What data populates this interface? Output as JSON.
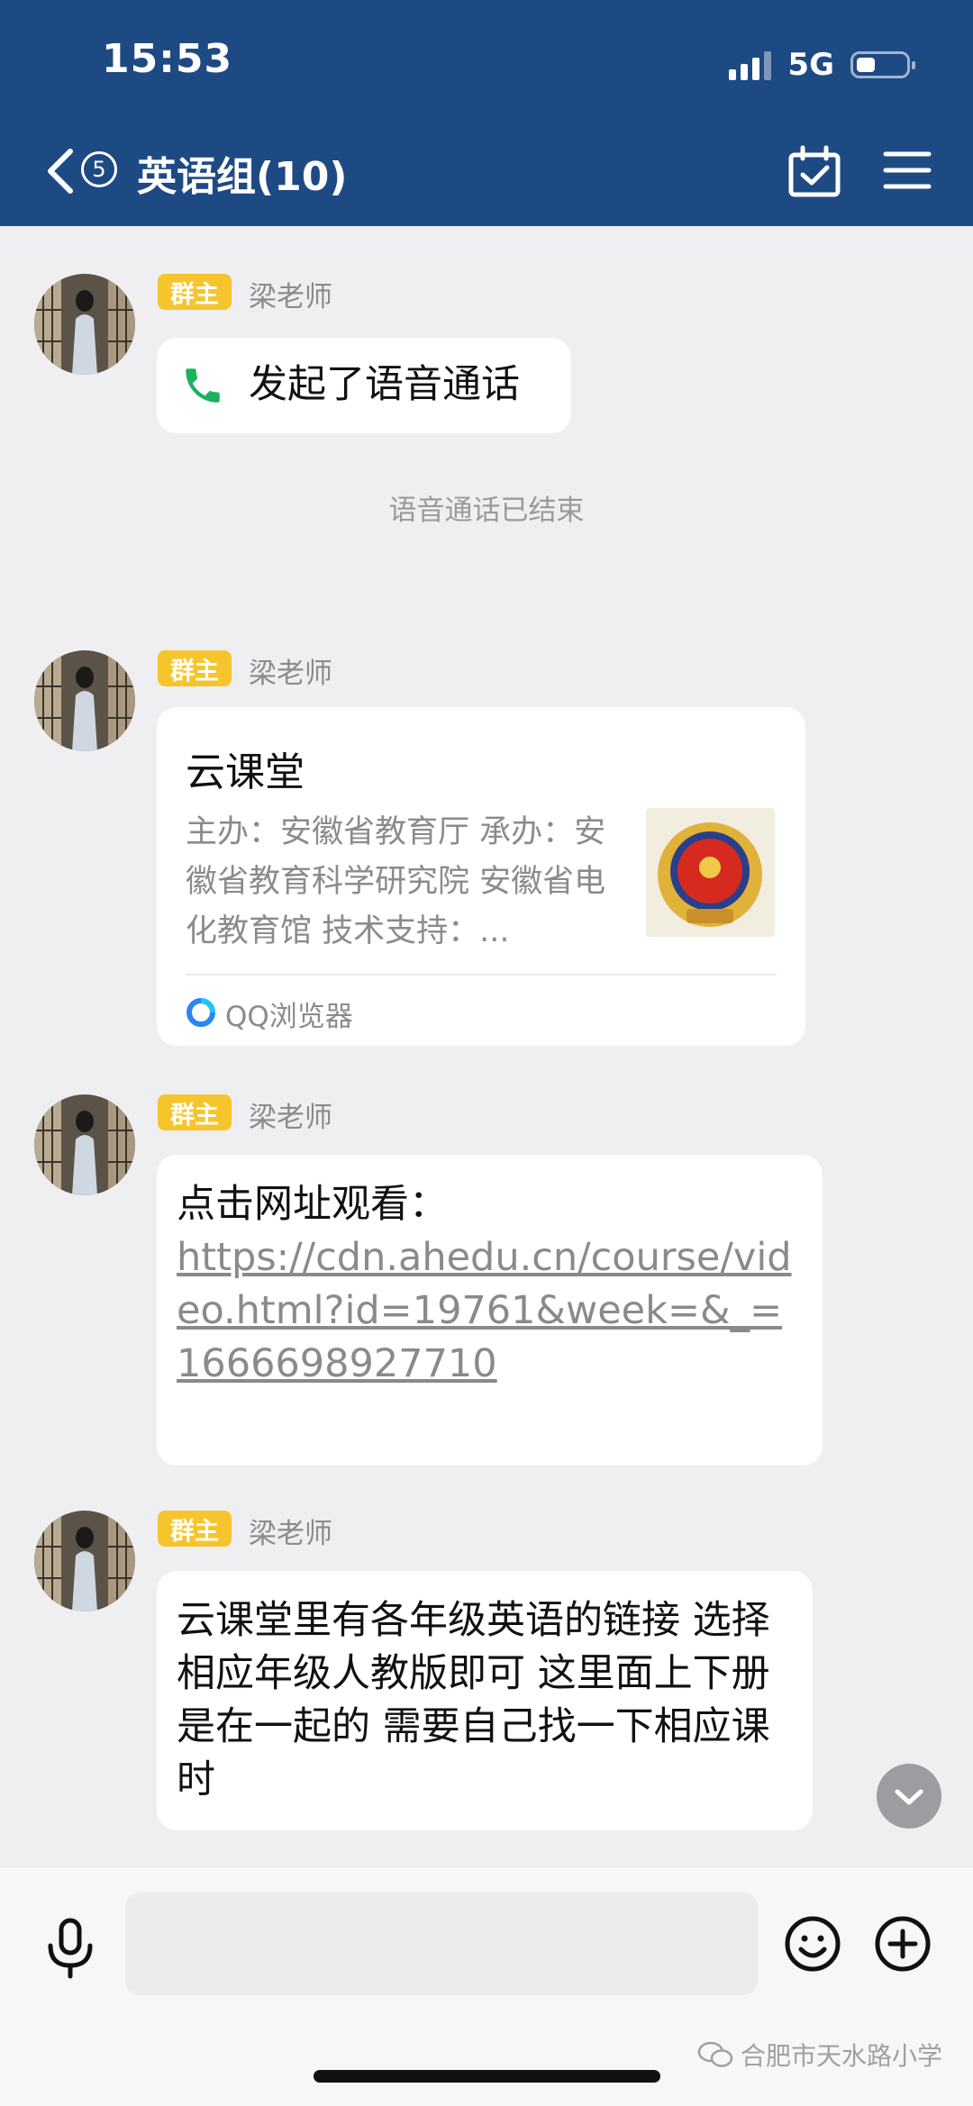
{
  "status_bar": {
    "time": "15:53",
    "network": "5G"
  },
  "header": {
    "unread_count": "5",
    "title": "英语组(10)"
  },
  "messages": [
    {
      "badge": "群主",
      "sender": "梁老师",
      "text": "发起了语音通话"
    },
    {
      "badge": "群主",
      "sender": "梁老师",
      "card": {
        "title": "云课堂",
        "desc": "主办：安徽省教育厅 承办：安徽省教育科学研究院 安徽省电化教育馆 技术支持：...",
        "source": "QQ浏览器"
      }
    },
    {
      "badge": "群主",
      "sender": "梁老师",
      "prefix": "点击网址观看：",
      "link": "https://cdn.ahedu.cn/course/video.html?id=19761&week=&_=1666698927710"
    },
    {
      "badge": "群主",
      "sender": "梁老师",
      "text": "云课堂里有各年级英语的链接 选择相应年级人教版即可 这里面上下册是在一起的 需要自己找一下相应课时"
    }
  ],
  "system_note": "语音通话已结束",
  "watermark": "合肥市天水路小学",
  "colors": {
    "header_bg": "#1e4a84",
    "badge": "#f6c52d",
    "call_green": "#18b35e",
    "page_bg": "#efeff1"
  }
}
